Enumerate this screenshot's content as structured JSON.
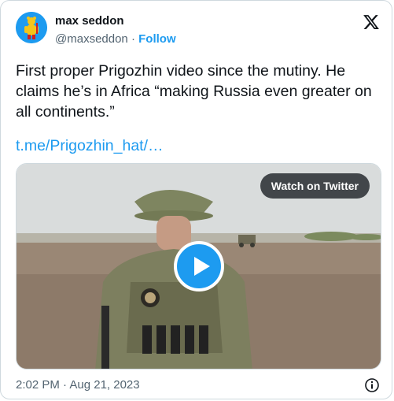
{
  "author": {
    "name": "max seddon",
    "handle": "@maxseddon",
    "separator": "·",
    "follow_label": "Follow"
  },
  "tweet": {
    "text": "First proper Prigozhin video since the mutiny. He claims he’s in Africa “making Russia even greater on all continents.”",
    "link": "t.me/Prigozhin_hat/…"
  },
  "media": {
    "watch_label": "Watch on Twitter"
  },
  "footer": {
    "timestamp": "2:02 PM · Aug 21, 2023"
  },
  "icons": {
    "brand": "x-logo-icon",
    "play": "play-icon",
    "info": "info-icon"
  },
  "colors": {
    "accent": "#1d9bf0",
    "text": "#0f1419",
    "secondary": "#536471",
    "border": "#cfd9de"
  }
}
